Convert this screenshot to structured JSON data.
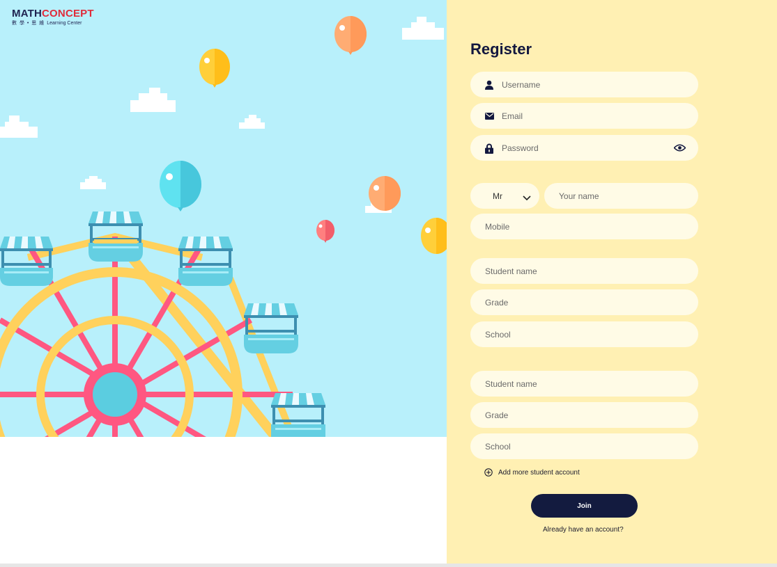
{
  "logo": {
    "brand_prefix": "MATH",
    "brand_accent": "CONCEPT",
    "sub_cn": "數 學 • 思 維",
    "sub_en": "Learning Center"
  },
  "form": {
    "title": "Register",
    "username": {
      "placeholder": "Username",
      "icon": "user-icon"
    },
    "email": {
      "placeholder": "Email",
      "icon": "envelope-icon"
    },
    "password": {
      "placeholder": "Password",
      "icon": "lock-icon",
      "toggle_icon": "eye-icon"
    },
    "salutation": {
      "value": "Mr"
    },
    "your_name": {
      "placeholder": "Your name"
    },
    "mobile": {
      "placeholder": "Mobile"
    },
    "students": [
      {
        "name_placeholder": "Student name",
        "grade_placeholder": "Grade",
        "school_placeholder": "School"
      },
      {
        "name_placeholder": "Student name",
        "grade_placeholder": "Grade",
        "school_placeholder": "School"
      }
    ],
    "add_more_label": "Add more student account",
    "join_label": "Join",
    "login_link": "Already have an account?"
  },
  "colors": {
    "accent": "#131b3f",
    "form_bg": "#fff0b3",
    "field_bg": "#fffbe6",
    "sky": "#b8f0fb"
  }
}
